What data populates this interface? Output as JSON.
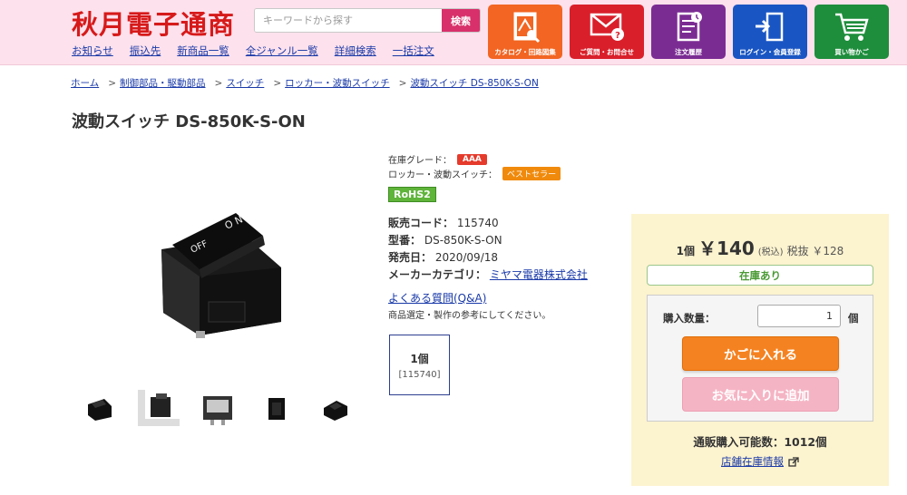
{
  "header": {
    "logo": "秋月電子通商",
    "search": {
      "placeholder": "キーワードから探す",
      "button": "検索"
    },
    "nav": [
      "お知らせ",
      "振込先",
      "新商品一覧",
      "全ジャンル一覧",
      "詳細検索",
      "一括注文"
    ],
    "icons": [
      {
        "label": "カタログ・回路図集",
        "icon": "catalog-icon",
        "color": "#f26522"
      },
      {
        "label": "ご質問・お問合せ",
        "icon": "mail-icon",
        "color": "#d91f2a"
      },
      {
        "label": "注文履歴",
        "icon": "order-history-icon",
        "color": "#7b2c93"
      },
      {
        "label": "ログイン・会員登録",
        "icon": "login-icon",
        "color": "#1a56c3"
      },
      {
        "label": "買い物かご",
        "icon": "cart-icon",
        "color": "#1e8d3c"
      }
    ]
  },
  "breadcrumb": [
    "ホーム",
    "制御部品・駆動部品",
    "スイッチ",
    "ロッカー・波動スイッチ",
    "波動スイッチ DS-850K-S-ON"
  ],
  "product": {
    "title": "波動スイッチ DS-850K-S-ON",
    "stock_grade_label": "在庫グレード：",
    "stock_grade": "AAA",
    "category_rank_label": "ロッカー・波動スイッチ：",
    "category_rank": "ベストセラー",
    "rohs": "RoHS2",
    "code_label": "販売コード：",
    "code": "115740",
    "model_label": "型番：",
    "model": "DS-850K-S-ON",
    "release_label": "発売日：",
    "release": "2020/09/18",
    "maker_label": "メーカーカテゴリ：",
    "maker": "ミヤマ電器株式会社",
    "faq": "よくある質問(Q&A)",
    "faq_note": "商品選定・製作の参考にしてください。",
    "variant": {
      "qty": "1個",
      "code": "[115740]"
    }
  },
  "buybox": {
    "qty_unit_prefix": "1個",
    "price": "￥140",
    "tax_in": "(税込)",
    "tax_ex": "税抜 ￥128",
    "stock_status": "在庫あり",
    "qty_label": "購入数量：",
    "qty_value": "1",
    "qty_unit": "個",
    "add_cart": "かごに入れる",
    "add_fav": "お気に入りに追加",
    "available": "通販購入可能数：1012個",
    "store_stock": "店舗在庫情報"
  },
  "colors": {
    "header_bg": "#fde1ec",
    "logo": "#d61a1a",
    "search_button": "#d8306a",
    "link": "#1a3aa8",
    "buybox_bg": "#fcf3cf",
    "cart_button": "#f58220",
    "fav_button": "#f5b4c4",
    "stock_ok": "#4a9a34"
  }
}
